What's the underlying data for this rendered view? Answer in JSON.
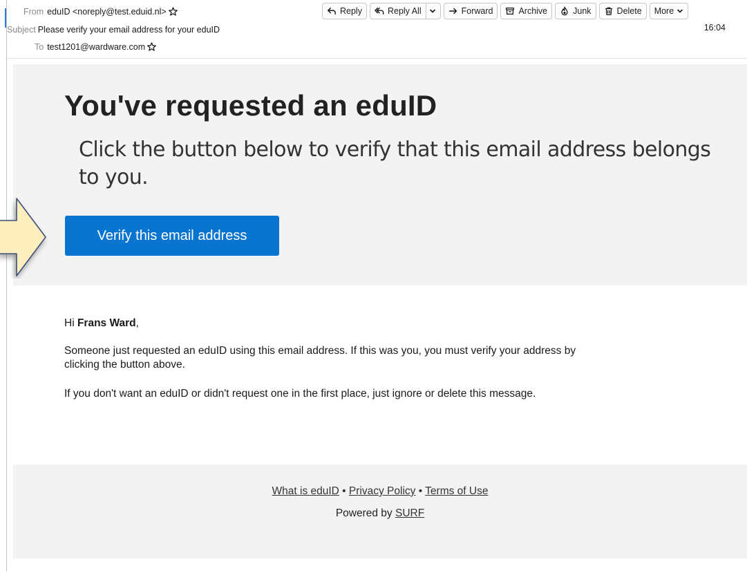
{
  "header": {
    "from_label": "From",
    "from_value": "eduID <noreply@test.eduid.nl>",
    "subject_label": "Subject",
    "subject_value": "Please verify your email address for your eduID",
    "to_label": "To",
    "to_value": "test1201@wardware.com",
    "time": "16:04"
  },
  "toolbar": {
    "reply": "Reply",
    "reply_all": "Reply All",
    "forward": "Forward",
    "archive": "Archive",
    "junk": "Junk",
    "delete": "Delete",
    "more": "More"
  },
  "email": {
    "title": "You've requested an eduID",
    "subtitle": "Click the button below to verify that this email address belongs to you.",
    "verify_button": "Verify this email address",
    "greeting_prefix": "Hi ",
    "greeting_name": "Frans Ward",
    "greeting_suffix": ",",
    "paragraph1": "Someone just requested an eduID using this email address. If this was you, you must verify your address by clicking the button above.",
    "paragraph2": "If you don't want an eduID or didn't request one in the first place, just ignore or delete this message."
  },
  "footer": {
    "link_what": "What is eduID",
    "separator": " • ",
    "link_privacy": "Privacy Policy",
    "link_terms": "Terms of Use",
    "powered_prefix": "Powered by ",
    "powered_link": "SURF"
  },
  "colors": {
    "button": "#0a74d1",
    "hero_bg": "#f3f3f3",
    "arrow_fill": "#fdeebe",
    "arrow_stroke": "#3c4f7a"
  }
}
